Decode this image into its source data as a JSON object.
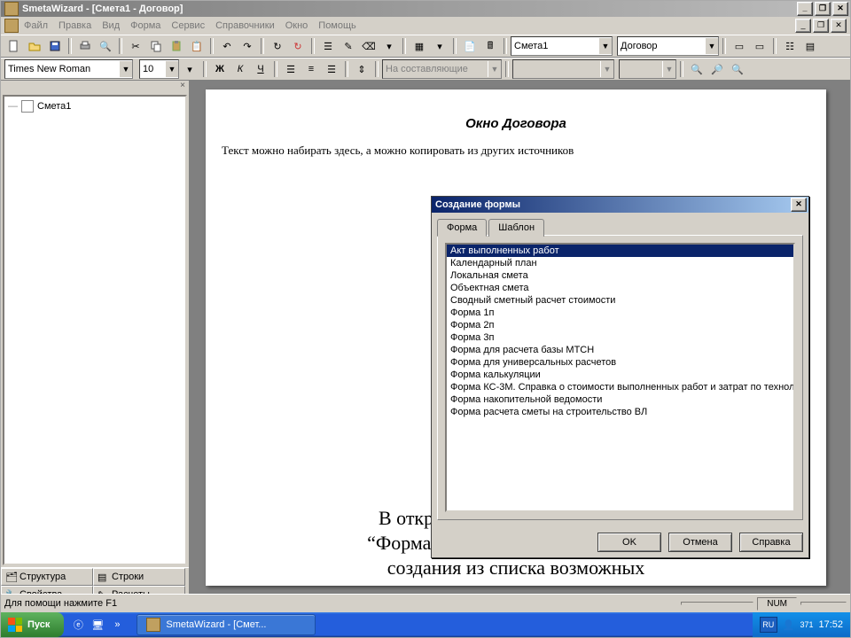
{
  "app": {
    "title": "SmetaWizard - [Смета1 - Договор]"
  },
  "menu": {
    "items": [
      "Файл",
      "Правка",
      "Вид",
      "Форма",
      "Сервис",
      "Справочники",
      "Окно",
      "Помощь"
    ]
  },
  "toolbar1": {
    "dropdown1": "Смета1",
    "dropdown2": "Договор"
  },
  "toolbar2": {
    "font": "Times New Roman",
    "size": "10",
    "disabled_label": "На составляющие"
  },
  "tree": {
    "root": "Смета1"
  },
  "sidetabs": {
    "a": "Структура",
    "b": "Строки",
    "c": "Свойства",
    "d": "Расчеты"
  },
  "page": {
    "heading": "Окно Договора",
    "bodytext": "Текст можно набирать здесь, а можно копировать из других источников",
    "caption1": "В открывшемся окне на закладке",
    "caption2": "“Форма” можно выбрать форму для",
    "caption3": "создания из списка возможных"
  },
  "dialog": {
    "title": "Создание формы",
    "tab1": "Форма",
    "tab2": "Шаблон",
    "items": [
      "Акт выполненных работ",
      "Календарный план",
      "Локальная смета",
      "Объектная смета",
      "Сводный сметный расчет стоимости",
      "Форма 1п",
      "Форма 2п",
      "Форма 3п",
      "Форма для расчета базы МТСН",
      "Форма для универсальных расчетов",
      "Форма калькуляции",
      "Форма КС-3М. Справка о стоимости выполненных работ и затрат по технолог",
      "Форма накопительной ведомости",
      "Форма расчета сметы на строительство ВЛ"
    ],
    "selected_index": 0,
    "ok": "OK",
    "cancel": "Отмена",
    "help": "Справка"
  },
  "status": {
    "hint": "Для помощи нажмите F1",
    "num": "NUM"
  },
  "taskbar": {
    "start": "Пуск",
    "task": "SmetaWizard - [Смет...",
    "lang": "RU",
    "tray_count": "371",
    "time": "17:52"
  }
}
